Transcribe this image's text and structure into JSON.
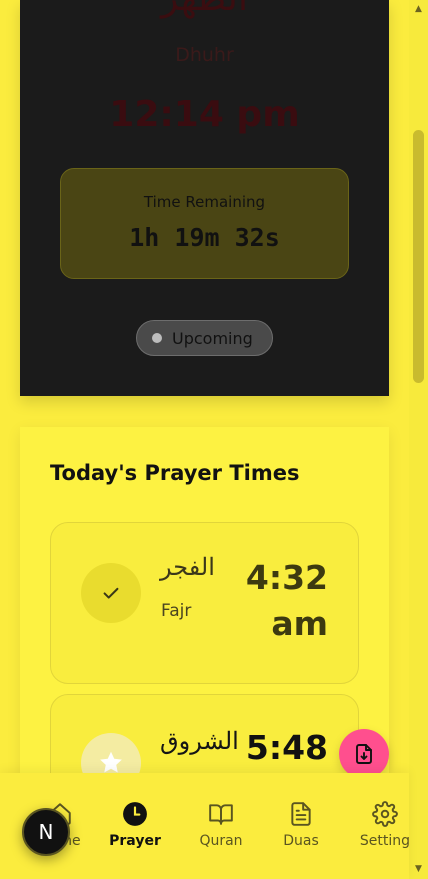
{
  "hero": {
    "arabic_name": "الظهر",
    "english_name": "Dhuhr",
    "time": "12:14 pm",
    "remaining_label": "Time Remaining",
    "remaining_value": "1h 19m 32s",
    "status": "Upcoming"
  },
  "prayer_times": {
    "heading": "Today's Prayer Times",
    "items": [
      {
        "arabic": "الفجر",
        "english": "Fajr",
        "time": "4:32 am",
        "state": "done",
        "icon": "check-icon"
      },
      {
        "arabic": "الشروق",
        "english": "",
        "time": "5:48",
        "state": "upcoming",
        "icon": "sun-icon"
      }
    ]
  },
  "nav": {
    "items": [
      {
        "label": "Home",
        "icon": "home-icon",
        "active": false
      },
      {
        "label": "Prayer",
        "icon": "clock-icon",
        "active": true
      },
      {
        "label": "Quran",
        "icon": "book-icon",
        "active": false
      },
      {
        "label": "Duas",
        "icon": "document-icon",
        "active": false
      },
      {
        "label": "Setting",
        "icon": "gear-icon",
        "active": false
      }
    ]
  },
  "avatar": {
    "initial": "N"
  },
  "fab": {
    "icon": "download-file-icon"
  },
  "colors": {
    "background": "#fbec3e",
    "hero_bg": "#1b1b1b",
    "accent_pink": "#ff4f8e"
  }
}
